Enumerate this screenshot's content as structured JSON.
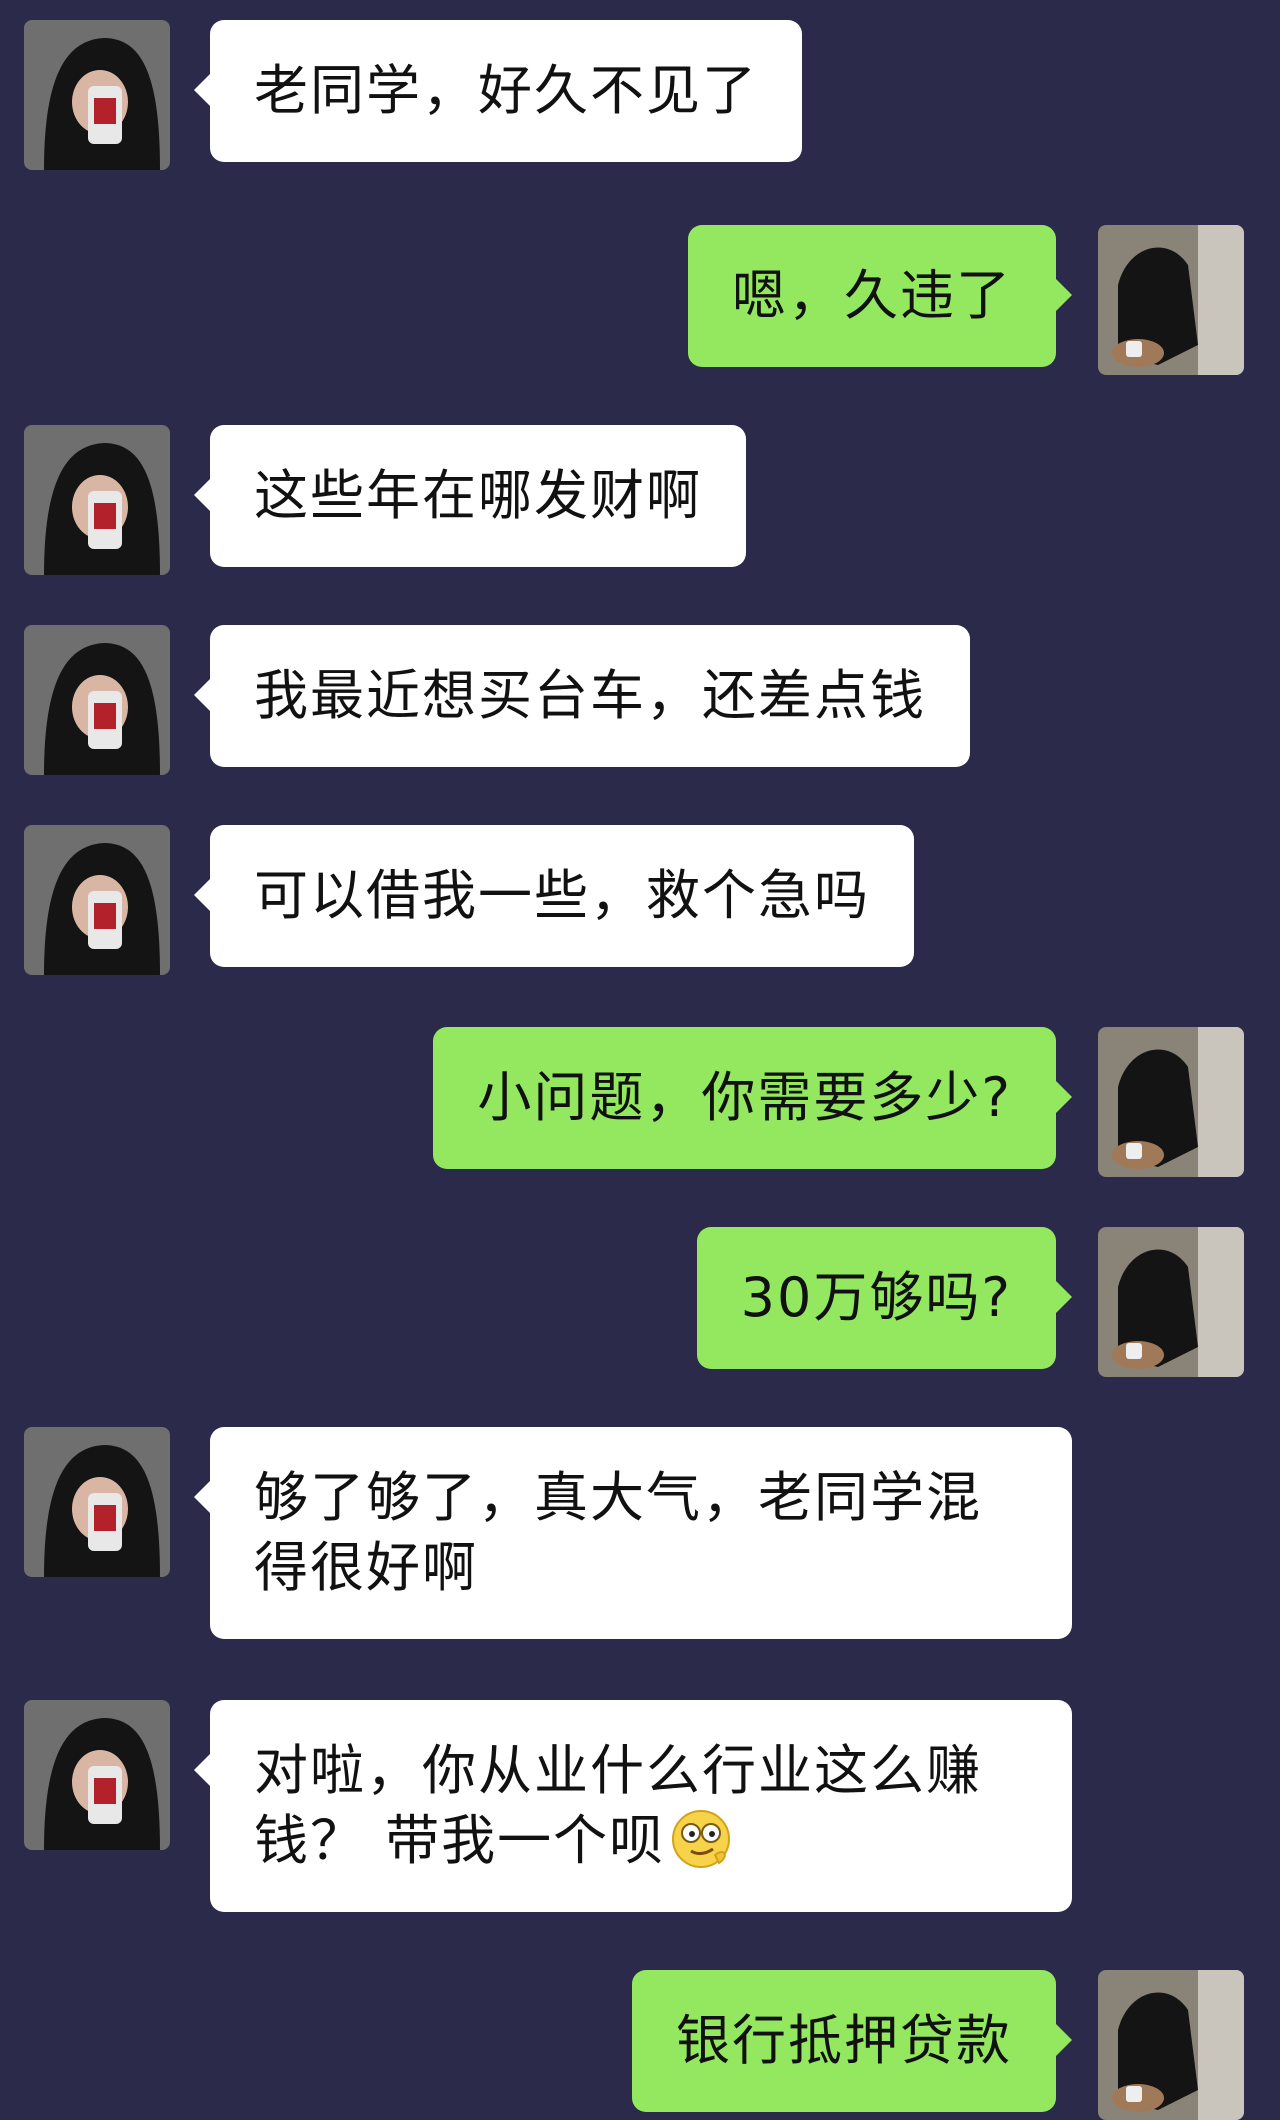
{
  "chat": {
    "messages": [
      {
        "side": "left",
        "text": "老同学，好久不见了"
      },
      {
        "side": "right",
        "text": "嗯，久违了"
      },
      {
        "side": "left",
        "text": "这些年在哪发财啊"
      },
      {
        "side": "left",
        "text": "我最近想买台车，还差点钱"
      },
      {
        "side": "left",
        "text": "可以借我一些，救个急吗"
      },
      {
        "side": "right",
        "text": "小问题，你需要多少?"
      },
      {
        "side": "right",
        "text": "30万够吗?"
      },
      {
        "side": "left",
        "text": "够了够了，真大气，老同学混得很好啊"
      },
      {
        "side": "left",
        "text": "对啦，你从业什么行业这么赚钱？ 带我一个呗",
        "emoji": "smirk-emoji"
      },
      {
        "side": "right",
        "text": "银行抵押贷款"
      }
    ]
  },
  "colors": {
    "background": "#2c2a4a",
    "incoming_bubble": "#ffffff",
    "outgoing_bubble": "#94e85f",
    "text": "#111111"
  },
  "icons": {
    "left_avatar": "hooded-person-avatar",
    "right_avatar": "seated-person-avatar",
    "emoji": "smirk-emoji"
  }
}
